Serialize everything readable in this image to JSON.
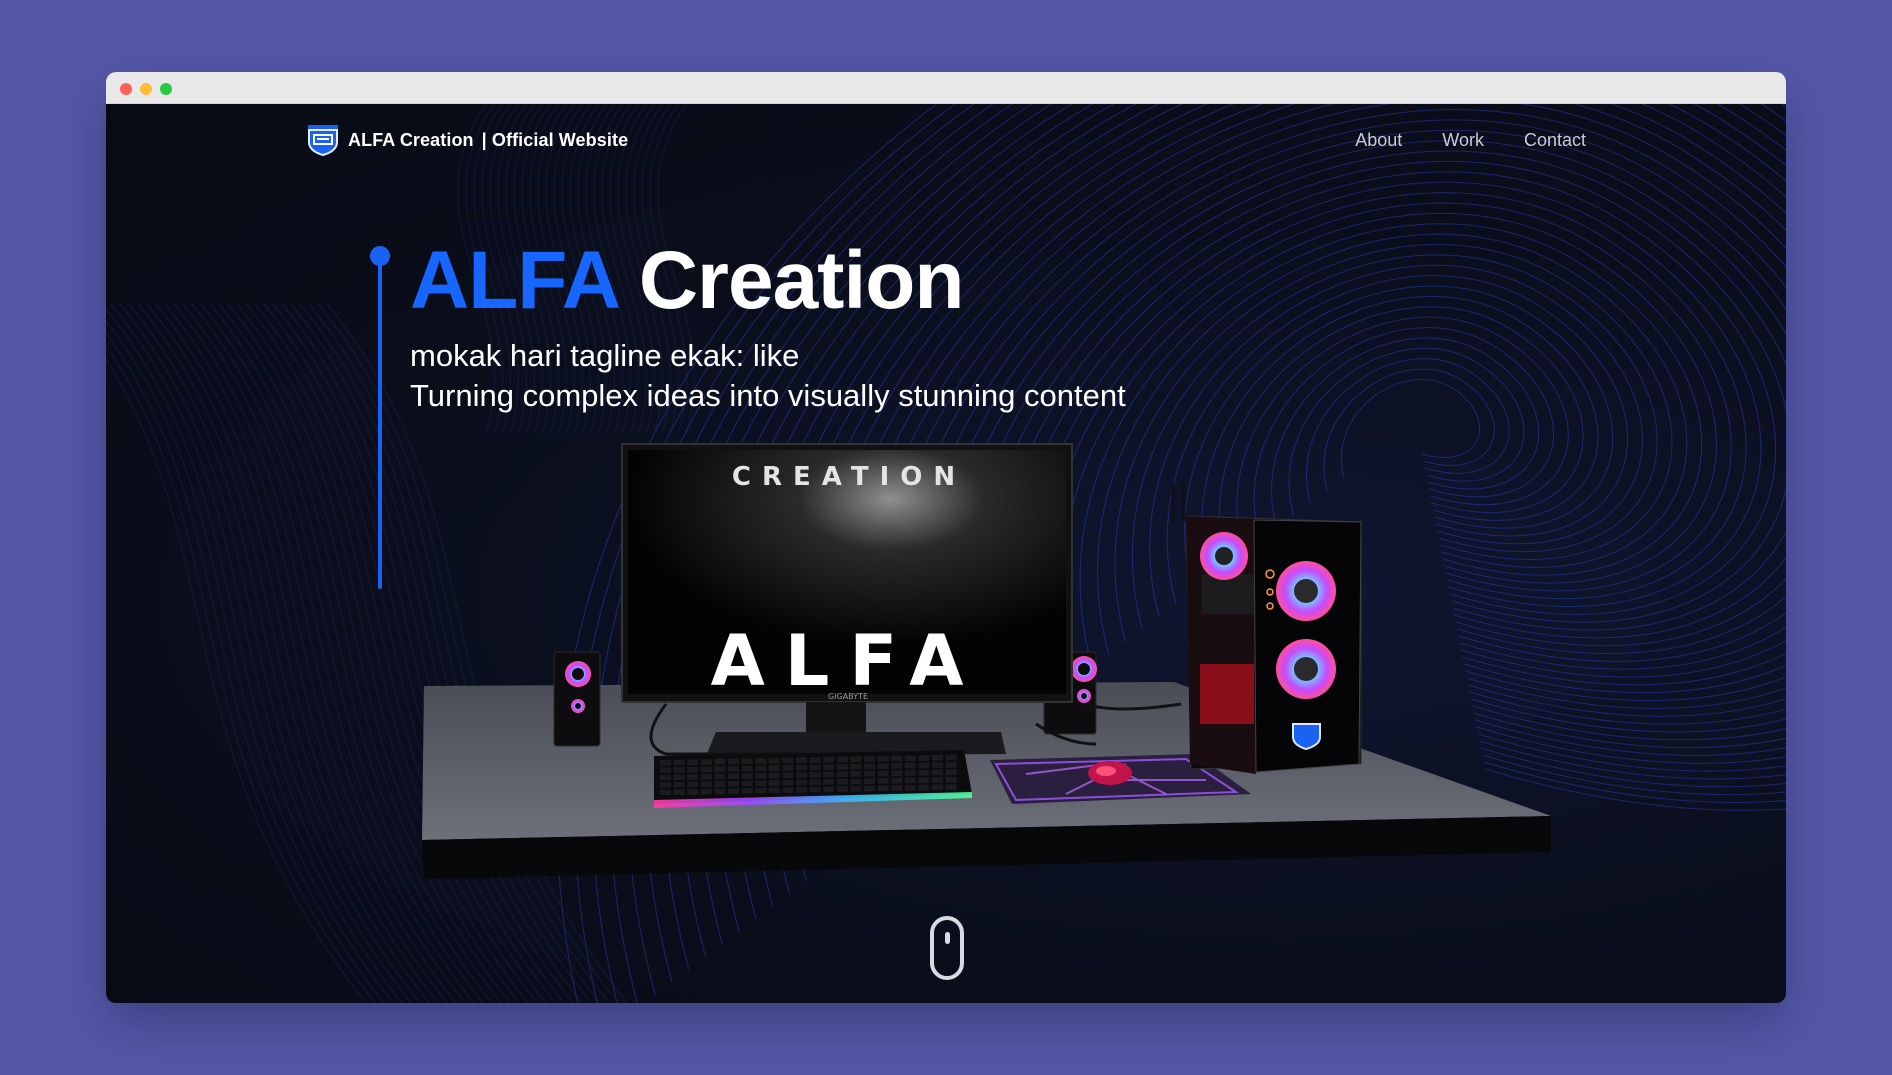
{
  "nav": {
    "brand": "ALFA Creation",
    "brand_suffix": "| Official Website",
    "links": [
      {
        "label": "About"
      },
      {
        "label": "Work"
      },
      {
        "label": "Contact"
      }
    ]
  },
  "hero": {
    "title_accent": "ALFA",
    "title_main": "Creation",
    "subtitle_line1": "mokak hari tagline ekak: like",
    "subtitle_line2": "Turning complex ideas into visually stunning content"
  },
  "scene": {
    "monitor_top_text": "CREATION",
    "monitor_logo_text": "ALFA",
    "monitor_brand": "GIGABYTE"
  },
  "colors": {
    "accent": "#1666ff",
    "page_background": "#0a0e1b",
    "outer_background": "#5558a8"
  },
  "icons": {
    "logo": "shield-logo-icon",
    "scroll": "mouse-scroll-icon"
  }
}
